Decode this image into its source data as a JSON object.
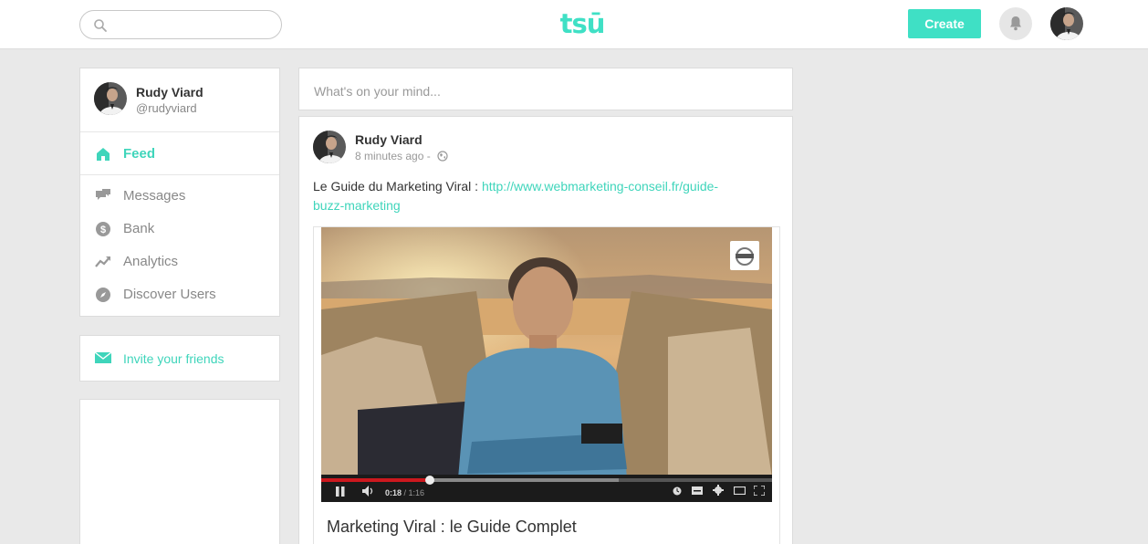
{
  "header": {
    "logo": "tsū",
    "search_placeholder": "",
    "create_label": "Create"
  },
  "profile": {
    "name": "Rudy Viard",
    "handle": "@rudyviard"
  },
  "nav": {
    "feed": "Feed",
    "items": [
      {
        "label": "Messages",
        "icon": "messages-icon"
      },
      {
        "label": "Bank",
        "icon": "bank-icon"
      },
      {
        "label": "Analytics",
        "icon": "analytics-icon"
      },
      {
        "label": "Discover Users",
        "icon": "discover-icon"
      }
    ]
  },
  "invite": {
    "label": "Invite your friends"
  },
  "composer": {
    "placeholder": "What's on your mind..."
  },
  "post": {
    "author": "Rudy Viard",
    "time": "8 minutes ago -",
    "text_prefix": "Le Guide du Marketing Viral : ",
    "link": "http://www.webmarketing-conseil.fr/guide-buzz-marketing",
    "video": {
      "current_time": "0:18",
      "duration": "1:16",
      "progress_fraction": 0.24,
      "buffered_fraction": 0.66
    },
    "embed_title": "Marketing Viral : le Guide Complet"
  },
  "colors": {
    "accent": "#3fe0c5",
    "link": "#3fd5bb",
    "progress": "#cc181e"
  }
}
